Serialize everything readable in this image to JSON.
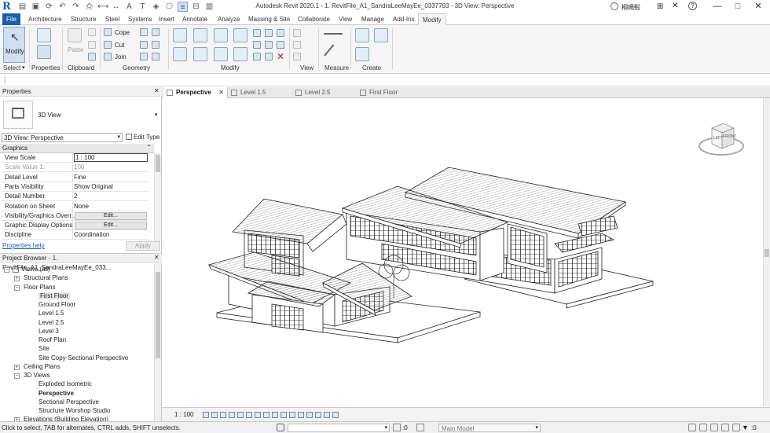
{
  "app": {
    "title": "Autodesk Revit 2020.1 - 1. RevitFile_A1_SandraLeeMayEe_0337793 - 3D View: Perspective",
    "logo": "R",
    "user": "桐啁鞡",
    "quick_access_icons": [
      "open-icon",
      "save-icon",
      "sync-icon",
      "undo-icon",
      "redo-icon",
      "print-icon",
      "measure-icon",
      "dimension-icon",
      "tag-icon",
      "text-icon",
      "3d-view-icon",
      "section-icon",
      "thin-lines-icon",
      "close-hidden-icon",
      "switch-windows-icon"
    ]
  },
  "tabs": [
    "File",
    "Architecture",
    "Structure",
    "Steel",
    "Systems",
    "Insert",
    "Annotate",
    "Analyze",
    "Massing & Site",
    "Collaborate",
    "View",
    "Manage",
    "Add-Ins",
    "Modify"
  ],
  "active_tab": "Modify",
  "ribbon": {
    "select": {
      "modify_label": "Modify",
      "panel_label": "Select"
    },
    "properties_panel": "Properties",
    "clipboard": {
      "paste_label": "Paste",
      "panel_label": "Clipboard"
    },
    "geometry": {
      "cope": "Cope",
      "cut": "Cut",
      "join": "Join",
      "panel_label": "Geometry"
    },
    "modify_panel": "Modify",
    "view_panel": "View",
    "measure_panel": "Measure",
    "create_panel": "Create"
  },
  "properties": {
    "header": "Properties",
    "type_name": "3D View",
    "instance_selector": "3D View: Perspective",
    "edit_type": "Edit Type",
    "group": "Graphics",
    "rows": [
      {
        "k": "View Scale",
        "v": "1 : 100",
        "boxed": true
      },
      {
        "k": "Scale Value    1:",
        "v": "100",
        "dim": true
      },
      {
        "k": "Detail Level",
        "v": "Fine"
      },
      {
        "k": "Parts Visibility",
        "v": "Show Original"
      },
      {
        "k": "Detail Number",
        "v": "2"
      },
      {
        "k": "Rotation on Sheet",
        "v": "None"
      },
      {
        "k": "Visibility/Graphics Overr...",
        "v": "Edit...",
        "button": true
      },
      {
        "k": "Graphic Display Options",
        "v": "Edit...",
        "button": true
      },
      {
        "k": "Discipline",
        "v": "Coordination"
      }
    ],
    "help_link": "Properties help",
    "apply": "Apply"
  },
  "browser": {
    "header": "Project Browser - 1. RevitFile_A1_SandraLeeMayEe_033...",
    "items": [
      {
        "label": "Views (all)",
        "level": 0,
        "toggle": "-"
      },
      {
        "label": "Structural Plans",
        "level": 1,
        "toggle": "+"
      },
      {
        "label": "Floor Plans",
        "level": 1,
        "toggle": "-"
      },
      {
        "label": "First Floor",
        "level": 2,
        "selected": true
      },
      {
        "label": "Ground Floor",
        "level": 2
      },
      {
        "label": "Level 1.5",
        "level": 2
      },
      {
        "label": "Level 2.5",
        "level": 2
      },
      {
        "label": "Level 3",
        "level": 2
      },
      {
        "label": "Roof Plan",
        "level": 2
      },
      {
        "label": "Site",
        "level": 2
      },
      {
        "label": "Site Copy-Sectional Perspective",
        "level": 2
      },
      {
        "label": "Ceiling Plans",
        "level": 1,
        "toggle": "+"
      },
      {
        "label": "3D Views",
        "level": 1,
        "toggle": "-"
      },
      {
        "label": "Exploded Isometric",
        "level": 2
      },
      {
        "label": "Perspective",
        "level": 2,
        "bold": true
      },
      {
        "label": "Sectional Perspective",
        "level": 2
      },
      {
        "label": "Structure Worshop Studio",
        "level": 2
      },
      {
        "label": "Elevations (Building Elevation)",
        "level": 1,
        "toggle": "+"
      }
    ]
  },
  "view_tabs": [
    {
      "label": "Perspective",
      "active": true
    },
    {
      "label": "Level 1.5"
    },
    {
      "label": "Level 2.5"
    },
    {
      "label": "First Floor"
    }
  ],
  "viewcube": {
    "left": "LEFT",
    "front": "FRONT"
  },
  "view_bar": {
    "scale": "1 : 100"
  },
  "status": {
    "message": "Click to select, TAB for alternates, CTRL adds, SHIFT unselects.",
    "count": ":0",
    "model": "Main Model",
    "filter": ":0"
  }
}
